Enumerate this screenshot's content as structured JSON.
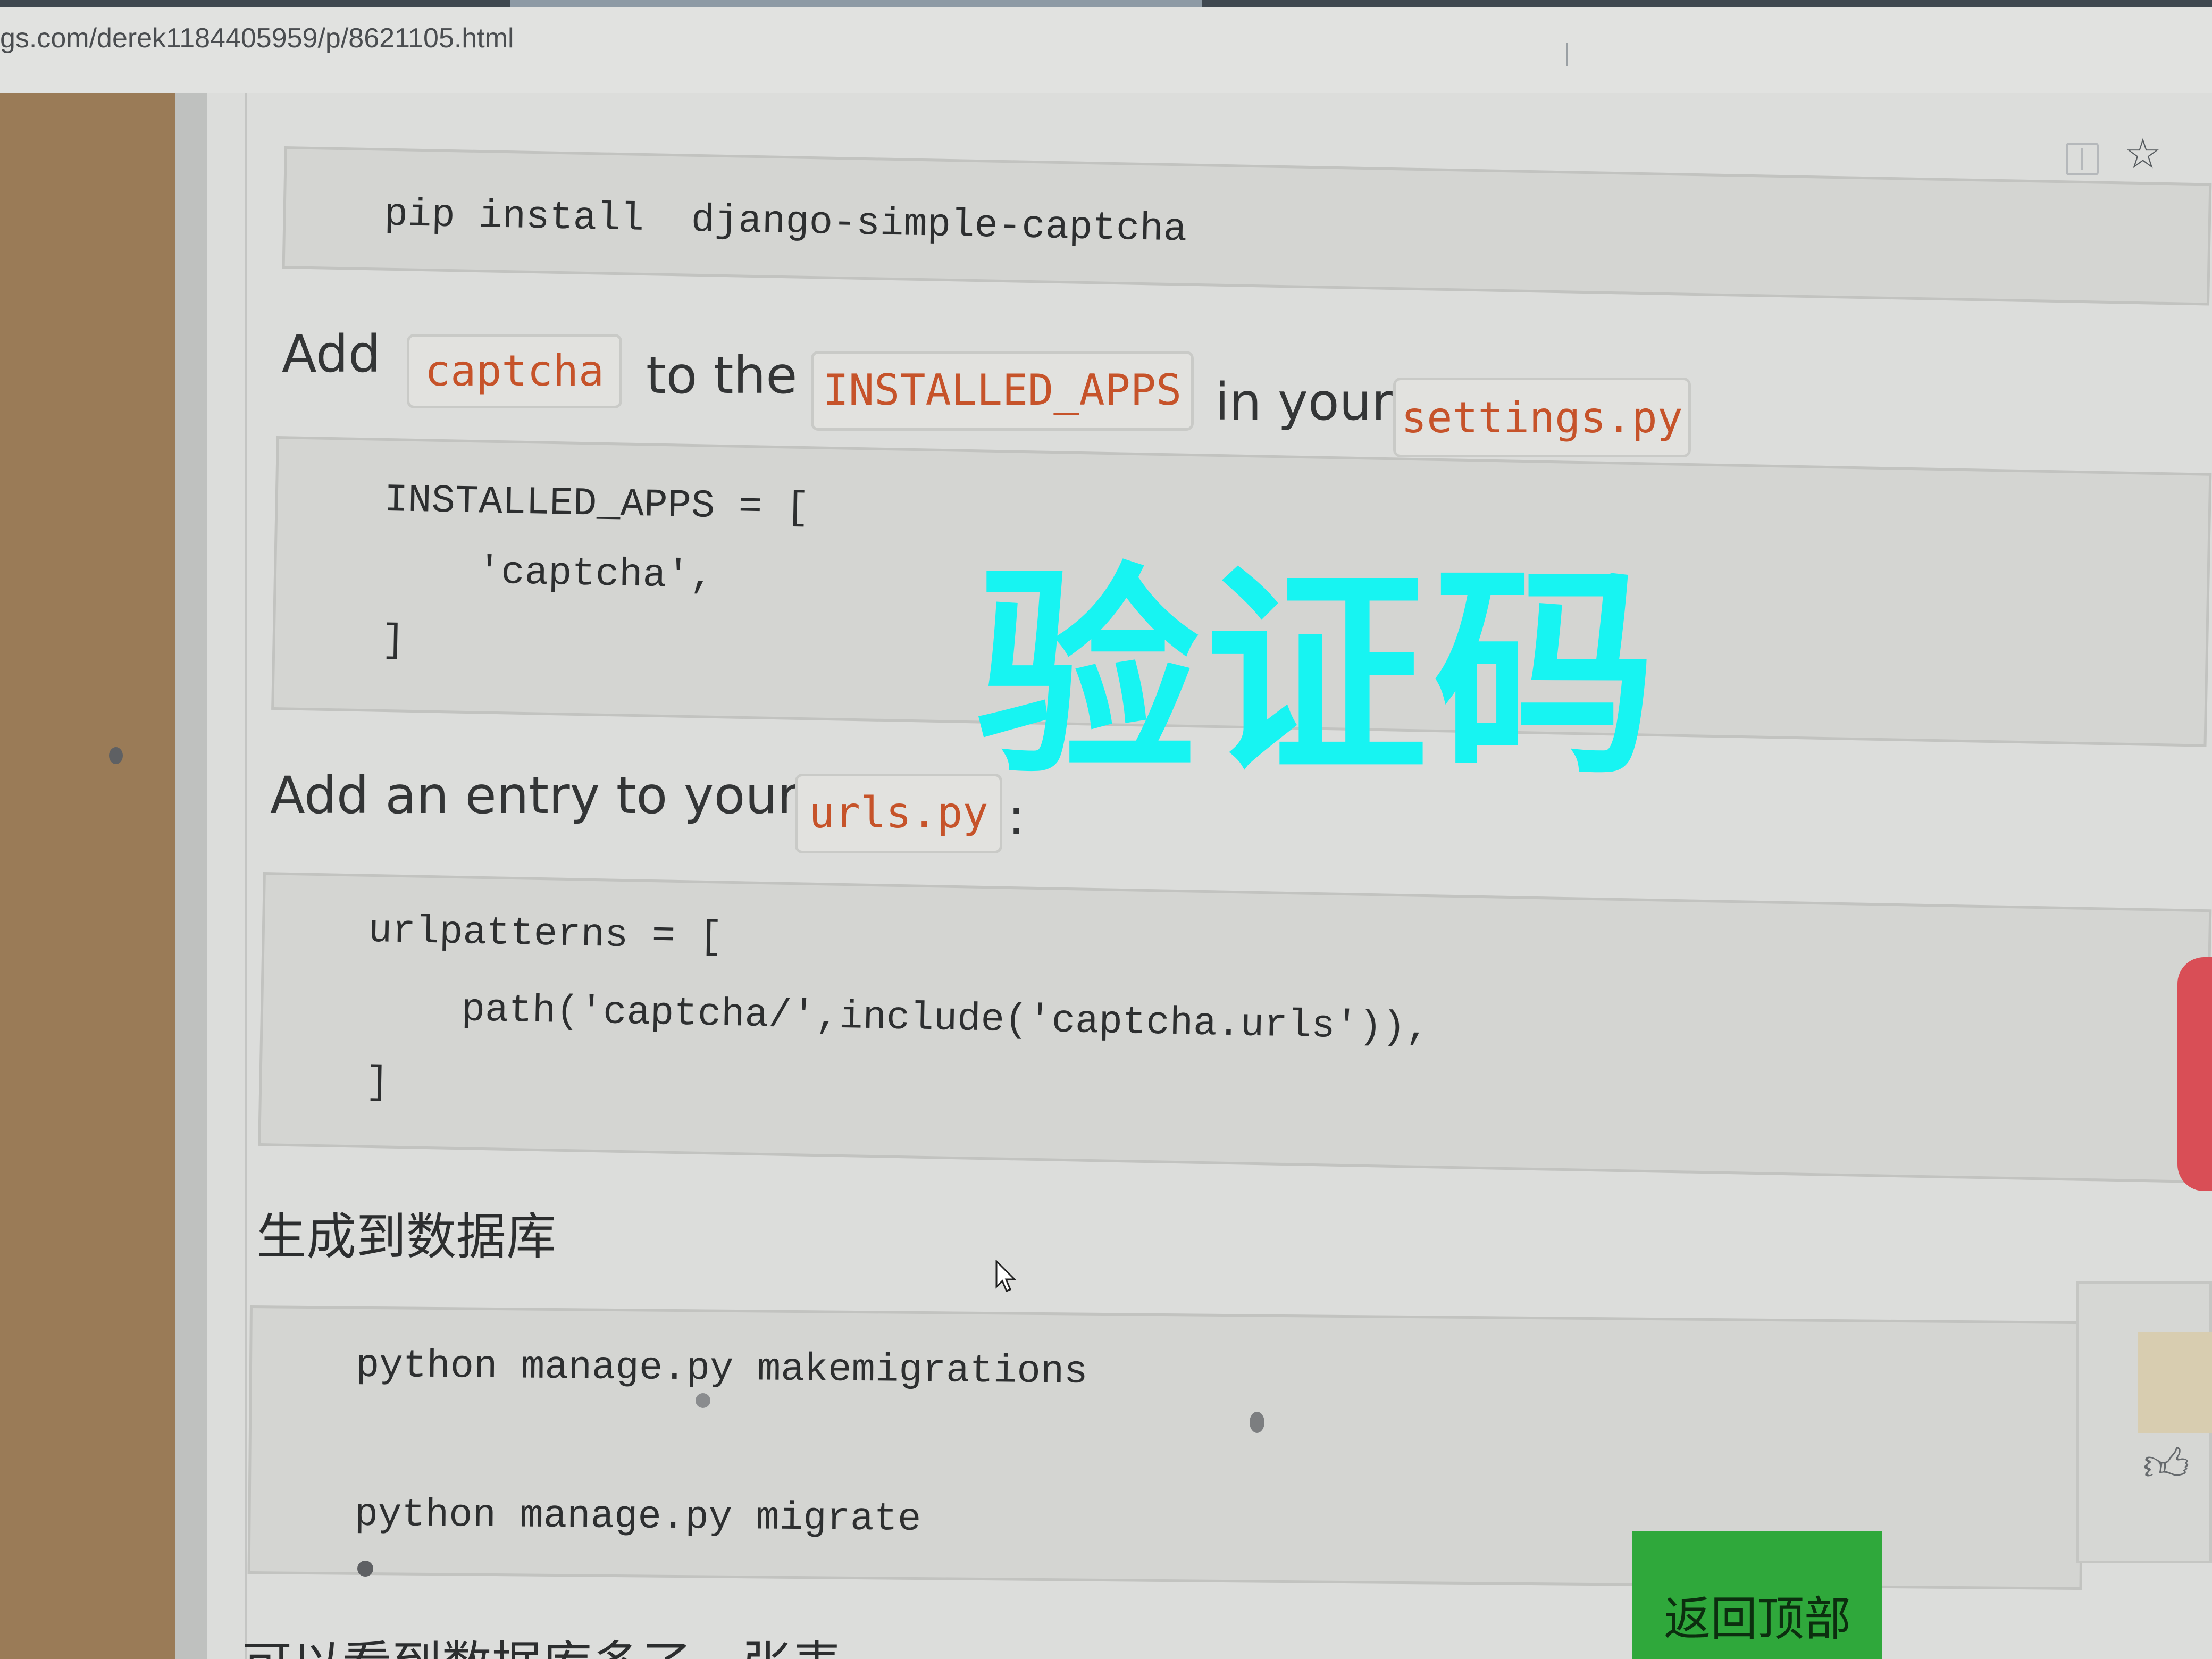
{
  "browser": {
    "url": "gs.com/derek1184405959/p/8621105.html"
  },
  "article": {
    "install_command": "pip install  django-simple-captcha",
    "step_add": {
      "text_add": "Add",
      "code_captcha": "captcha",
      "text_to_the": "to the",
      "code_installed_apps": "INSTALLED_APPS",
      "text_in_your": "in your",
      "code_settings": "settings.py"
    },
    "settings_code": [
      "INSTALLED_APPS = [",
      "    'captcha',",
      "]"
    ],
    "step_urls": {
      "text": "Add an entry to your",
      "code_urls": "urls.py",
      "colon": ":"
    },
    "urls_code": [
      "urlpatterns = [",
      "    path('captcha/',include('captcha.urls')),",
      "]"
    ],
    "db_heading": "生成到数据库",
    "migrate_code": [
      "python manage.py makemigrations",
      "python manage.py migrate"
    ],
    "next_heading": "可以看到数据库多了一张表"
  },
  "watermark": "验证码",
  "back_to_top": "返回顶部",
  "icons": {
    "reader": "reader-mode-icon",
    "bookmark": "star-icon",
    "cursor": "mouse-pointer-icon",
    "like": "thumbs-up-icon"
  },
  "colors": {
    "inline_code": "#c6532a",
    "watermark": "#17f4f2",
    "back_to_top_bg": "#2fa83b",
    "side_tab": "#d94e56"
  }
}
